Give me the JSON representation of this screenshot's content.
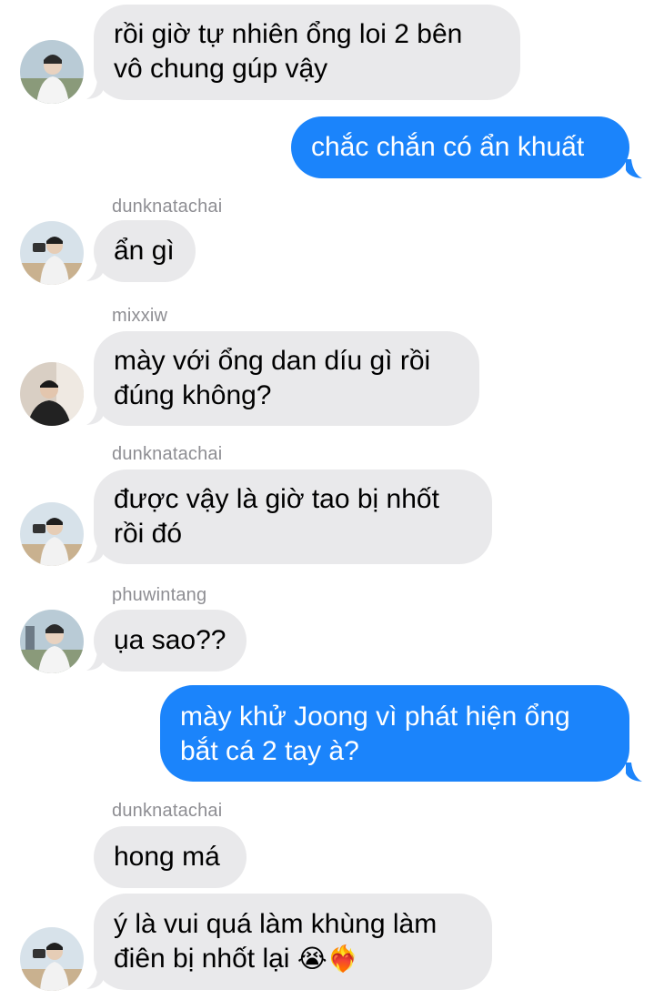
{
  "messages": [
    {
      "direction": "incoming",
      "sender": "",
      "text_lines": [
        "rồi giờ tự nhiên ổng loi 2 bên",
        "vô chung gúp vậy"
      ]
    },
    {
      "direction": "outgoing",
      "text_lines": [
        "chắc chắn có ẩn khuất"
      ]
    },
    {
      "direction": "incoming",
      "sender": "dunknatachai",
      "text_lines": [
        "ẩn gì"
      ]
    },
    {
      "direction": "incoming",
      "sender": "mixxiw",
      "text_lines": [
        "mày với ổng dan díu gì rồi",
        "đúng không?"
      ]
    },
    {
      "direction": "incoming",
      "sender": "dunknatachai",
      "text_lines": [
        "được vậy là giờ tao bị nhốt",
        "rồi đó"
      ]
    },
    {
      "direction": "incoming",
      "sender": "phuwintang",
      "text_lines": [
        "ụa sao??"
      ]
    },
    {
      "direction": "outgoing",
      "text_lines": [
        "mày khử Joong vì phát hiện ổng",
        "bắt cá 2 tay à?"
      ]
    },
    {
      "direction": "incoming",
      "sender": "dunknatachai",
      "text_lines": [
        "hong má"
      ]
    },
    {
      "direction": "incoming",
      "sender": "",
      "text_lines": [
        "ý là vui quá làm khùng làm",
        "điên bị nhốt lại"
      ],
      "emojis": [
        "😭",
        "❤️‍🔥"
      ]
    }
  ],
  "colors": {
    "incoming_bubble": "#e9e9eb",
    "outgoing_bubble": "#1b84fb",
    "sender_name": "#8e8e93"
  },
  "avatar_icons": [
    "person-avatar-icon"
  ]
}
